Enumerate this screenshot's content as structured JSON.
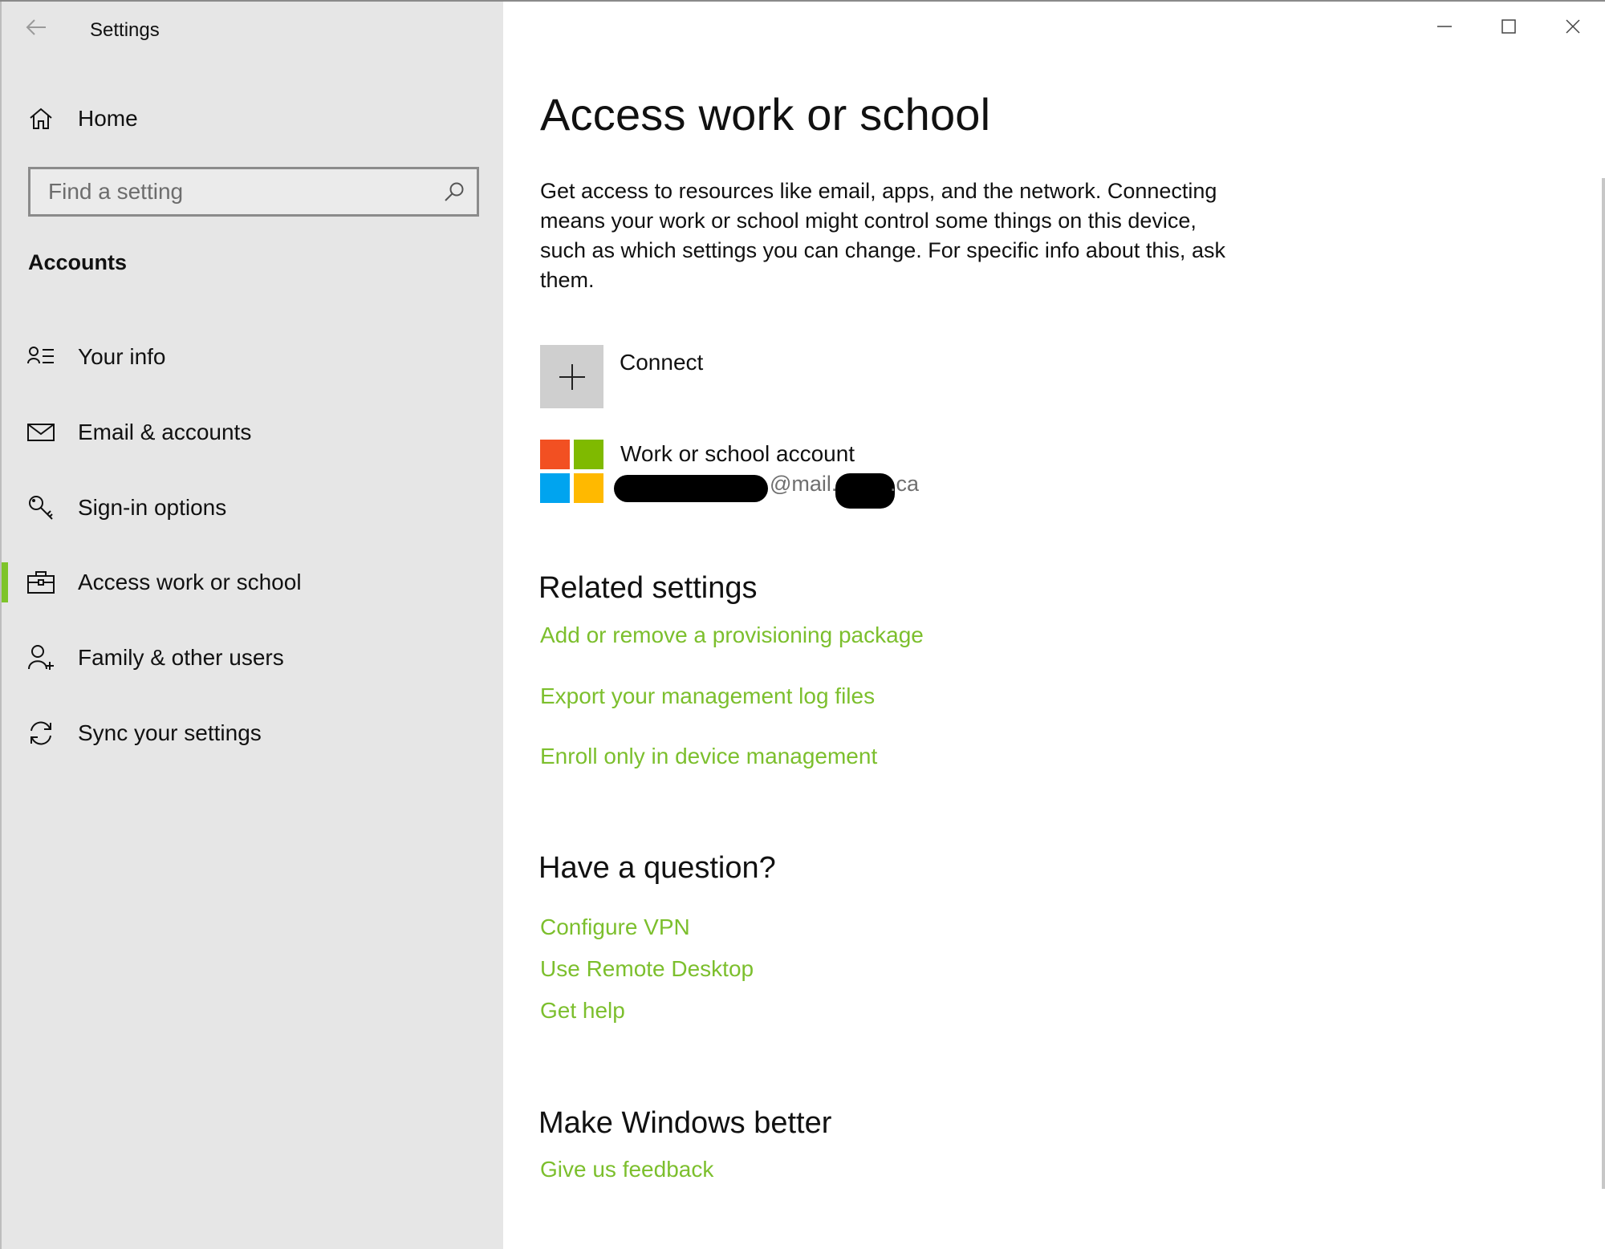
{
  "titlebar": {
    "app_title": "Settings",
    "back_icon": "back-arrow-icon",
    "minimize_icon": "minimize-icon",
    "maximize_icon": "maximize-icon",
    "close_icon": "close-icon"
  },
  "sidebar": {
    "home_label": "Home",
    "search_placeholder": "Find a setting",
    "section_title": "Accounts",
    "items": [
      {
        "label": "Your info",
        "icon": "contact-card-icon"
      },
      {
        "label": "Email & accounts",
        "icon": "mail-icon"
      },
      {
        "label": "Sign-in options",
        "icon": "key-icon"
      },
      {
        "label": "Access work or school",
        "icon": "briefcase-icon",
        "selected": true
      },
      {
        "label": "Family & other users",
        "icon": "add-person-icon"
      },
      {
        "label": "Sync your settings",
        "icon": "sync-icon"
      }
    ]
  },
  "main": {
    "title": "Access work or school",
    "intro": "Get access to resources like email, apps, and the network. Connecting means your work or school might control some things on this device, such as which settings you can change. For specific info about this, ask them.",
    "connect_label": "Connect",
    "account": {
      "title": "Work or school account",
      "email_middle": "@mail.",
      "email_suffix": ".ca"
    },
    "related_title": "Related settings",
    "related_links": [
      "Add or remove a provisioning package",
      "Export your management log files",
      "Enroll only in device management"
    ],
    "question_title": "Have a question?",
    "question_links": [
      "Configure VPN",
      "Use Remote Desktop",
      "Get help"
    ],
    "better_title": "Make Windows better",
    "feedback_link": "Give us feedback"
  },
  "colors": {
    "accent": "#7cbf2d",
    "sidebar_bg": "#e6e6e6",
    "ms_red": "#f25022",
    "ms_green": "#7fba00",
    "ms_blue": "#00a4ef",
    "ms_yellow": "#ffb900"
  }
}
